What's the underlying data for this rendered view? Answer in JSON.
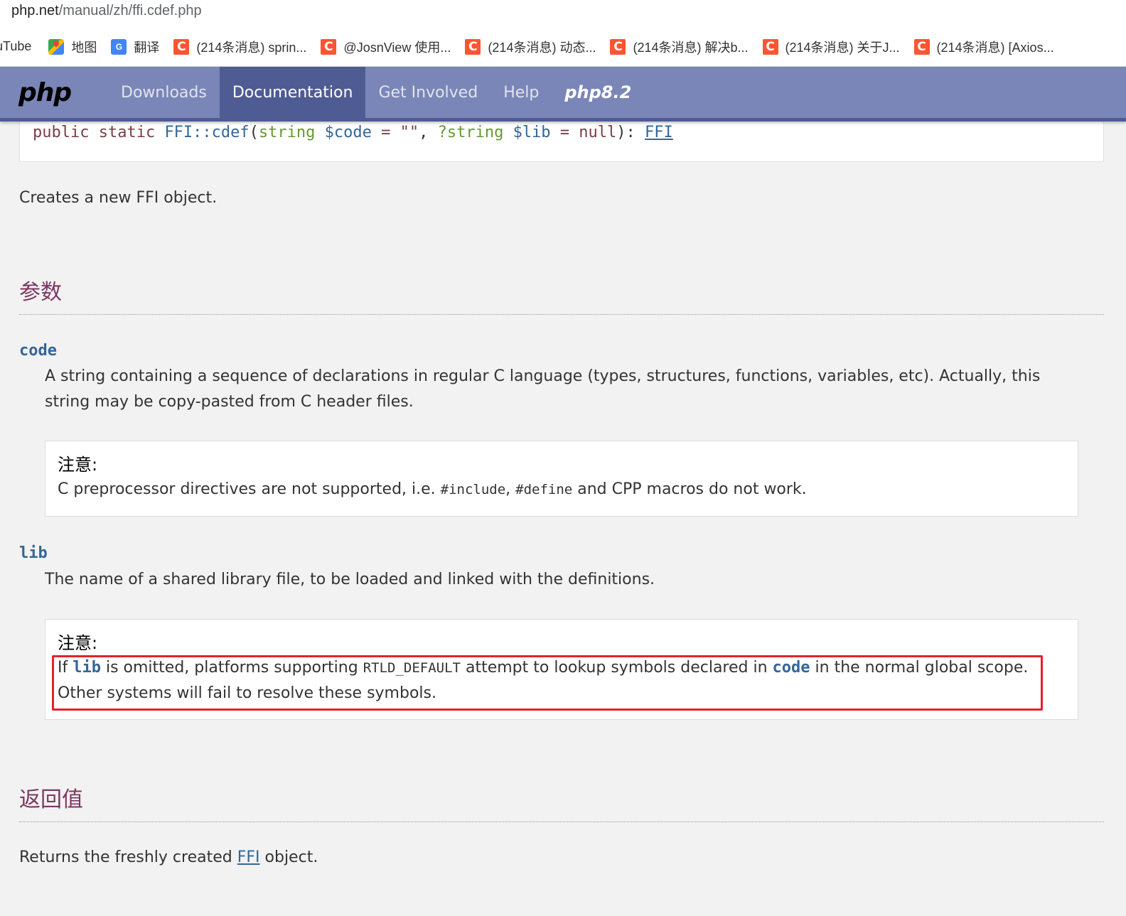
{
  "browser": {
    "url_host": "php.net",
    "url_path": "/manual/zh/ffi.cdef.php",
    "bookmarks": [
      {
        "label": "uTube",
        "icon": "youtube-icon"
      },
      {
        "label": "地图",
        "icon": "maps-icon"
      },
      {
        "label": "翻译",
        "icon": "translate-icon"
      },
      {
        "label": "(214条消息) sprin...",
        "icon": "csdn-icon"
      },
      {
        "label": "@JosnView 使用...",
        "icon": "csdn-icon"
      },
      {
        "label": "(214条消息) 动态...",
        "icon": "csdn-icon"
      },
      {
        "label": "(214条消息) 解决b...",
        "icon": "csdn-icon"
      },
      {
        "label": "(214条消息) 关于J...",
        "icon": "csdn-icon"
      },
      {
        "label": "(214条消息) [Axios...",
        "icon": "csdn-icon"
      }
    ],
    "csdn_glyph": "C"
  },
  "nav": {
    "logo": "php",
    "items": [
      "Downloads",
      "Documentation",
      "Get Involved",
      "Help"
    ],
    "active": "Documentation",
    "version": "php8.2"
  },
  "signature": {
    "modifiers": "public static ",
    "class_method": "FFI::cdef",
    "open": "(",
    "p1_type": "string",
    "p1_var": " $code",
    "p1_default": " = \"\"",
    "sep": ", ",
    "p2_type": "?string",
    "p2_var": " $lib",
    "p2_default": " = null",
    "close": "): ",
    "return_type": "FFI"
  },
  "description": "Creates a new FFI object.",
  "params_heading": "参数",
  "params": [
    {
      "name": "code",
      "desc": "A string containing a sequence of declarations in regular C language (types, structures, functions, variables, etc). Actually, this string may be copy-pasted from C header files.",
      "note_title": "注意:",
      "note_t1": "C preprocessor directives are not supported, i.e. ",
      "note_c1": "#include",
      "note_t2": ", ",
      "note_c2": "#define",
      "note_t3": " and CPP macros do not work."
    },
    {
      "name": "lib",
      "desc": "The name of a shared library file, to be loaded and linked with the definitions.",
      "note_title": "注意:",
      "note_t1": "If ",
      "note_c1": "lib",
      "note_t2": " is omitted, platforms supporting ",
      "note_c2": "RTLD_DEFAULT",
      "note_t3": " attempt to lookup symbols declared in ",
      "note_c3": "code",
      "note_t4": " in the normal global scope. Other systems will fail to resolve these symbols."
    }
  ],
  "return_heading": "返回值",
  "return": {
    "t1": "Returns the freshly created ",
    "link": "FFI",
    "t2": " object."
  },
  "colors": {
    "nav_bg": "#7a86b8",
    "nav_active": "#4f5b93",
    "heading": "#793862",
    "link": "#336699",
    "highlight_border": "#e5222a"
  }
}
